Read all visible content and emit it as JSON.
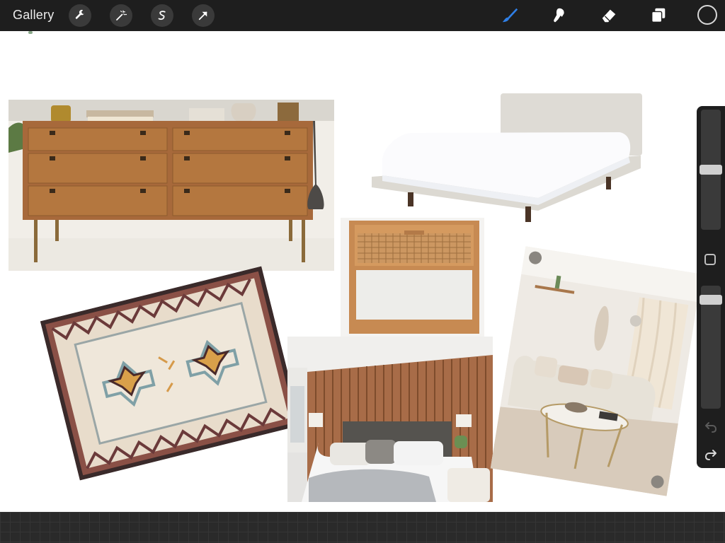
{
  "toolbar": {
    "gallery_label": "Gallery",
    "left_tools": [
      "wrench-icon",
      "magic-wand-icon",
      "selection-s-icon",
      "transform-arrow-icon"
    ],
    "right_tools": [
      "brush-icon",
      "smudge-icon",
      "eraser-icon",
      "layers-icon"
    ],
    "active_tool": "brush-icon",
    "active_color": "#1e1e1e",
    "accent": "#2f7fe6"
  },
  "canvas": {
    "background": "#ffffff",
    "images": [
      "dresser",
      "bed",
      "nightstand",
      "rug",
      "living-room",
      "bedroom"
    ]
  },
  "sidebar": {
    "brush_size_level": 0.5,
    "opacity_level": 0.92,
    "buttons": [
      "modify-button",
      "undo-icon",
      "redo-icon"
    ]
  }
}
